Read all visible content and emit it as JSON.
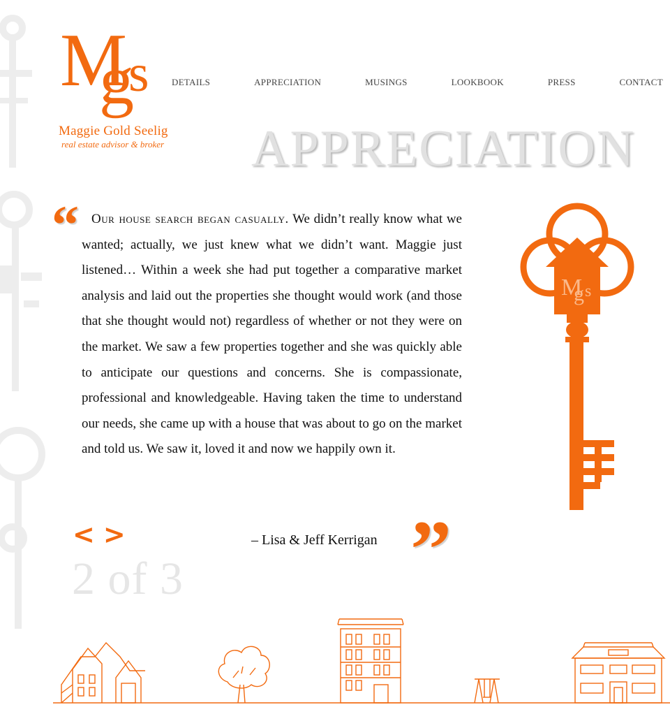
{
  "brand": {
    "monogram": "Mgs",
    "name": "Maggie Gold Seelig",
    "tagline": "real estate advisor & broker",
    "accent_color": "#f26a10"
  },
  "nav": {
    "items": [
      {
        "label": "DETAILS"
      },
      {
        "label": "APPRECIATION"
      },
      {
        "label": "MUSINGS"
      },
      {
        "label": "LOOKBOOK"
      },
      {
        "label": "PRESS"
      },
      {
        "label": "CONTACT"
      }
    ]
  },
  "page": {
    "heading": "APPRECIATION"
  },
  "testimonial": {
    "lead_in": "Our house search began casually.",
    "body": "We didn’t really know what we wanted; actually, we just knew what we didn’t want. Maggie just listened… Within a week she had put together a comparative market analysis and laid out the properties she thought would work (and those that she thought would not) regardless of whether or not they were on the market. We saw a few properties together and she was quickly able to anticipate our questions and concerns. She is compassionate, professional and knowledgeable. Having taken the time to understand our needs, she came up with a house that was about to go on the market and told us. We saw it, loved it and now we happily own it.",
    "attribution": "– Lisa & Jeff Kerrigan",
    "open_quote": "“",
    "close_quote": "”"
  },
  "pager": {
    "prev": "<",
    "next": ">",
    "counter": "2 of 3"
  },
  "icons": {
    "key": "key-icon",
    "prev": "chevron-left-icon",
    "next": "chevron-right-icon"
  }
}
